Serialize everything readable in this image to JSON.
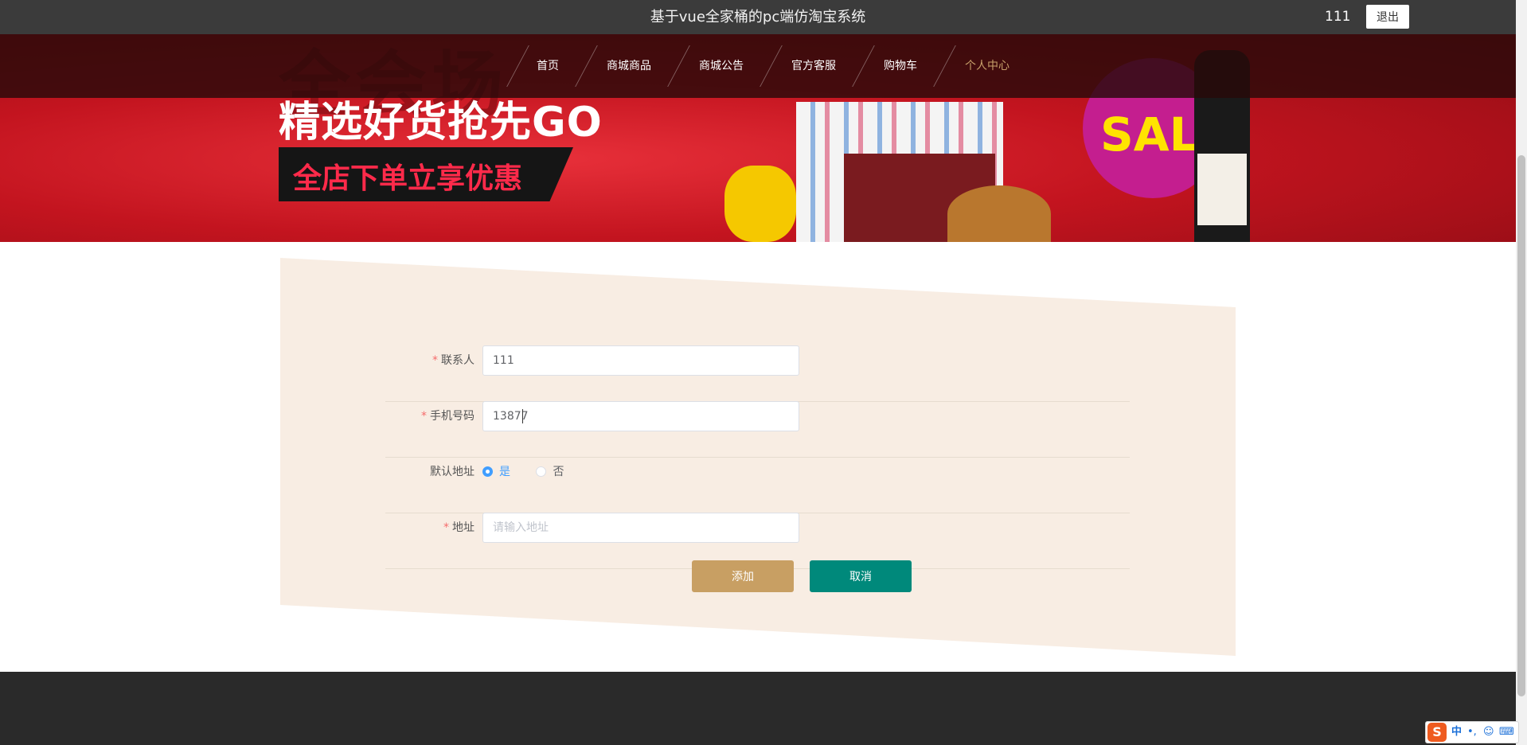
{
  "header": {
    "site_title": "基于vue全家桶的pc端仿淘宝系统",
    "username": "111",
    "logout_label": "退出"
  },
  "nav": {
    "items": [
      {
        "label": "首页"
      },
      {
        "label": "商城商品"
      },
      {
        "label": "商城公告"
      },
      {
        "label": "官方客服"
      },
      {
        "label": "购物车"
      },
      {
        "label": "个人中心",
        "current": true
      }
    ]
  },
  "banner": {
    "ghost_text": "全会场",
    "headline": "精选好货抢先GO",
    "subline": "全店下单立享优惠",
    "badge": "SALE",
    "slides": 3,
    "active_slide": 3
  },
  "form": {
    "contact": {
      "label": "联系人",
      "required": true,
      "value": "111"
    },
    "phone": {
      "label": "手机号码",
      "required": true,
      "value": "13877"
    },
    "default_address": {
      "label": "默认地址",
      "options": [
        {
          "label": "是",
          "checked": true
        },
        {
          "label": "否",
          "checked": false
        }
      ]
    },
    "address": {
      "label": "地址",
      "required": true,
      "value": "",
      "placeholder": "请输入地址"
    },
    "add_label": "添加",
    "cancel_label": "取消"
  },
  "ime": {
    "logo": "S",
    "mode": "中",
    "punct": "•,",
    "emoji": "☺",
    "keyboard": "⌨"
  },
  "colors": {
    "primary_button": "#c89f63",
    "cancel_button": "#00897b",
    "radio_active": "#409eff",
    "required_mark": "#f56c6c"
  }
}
